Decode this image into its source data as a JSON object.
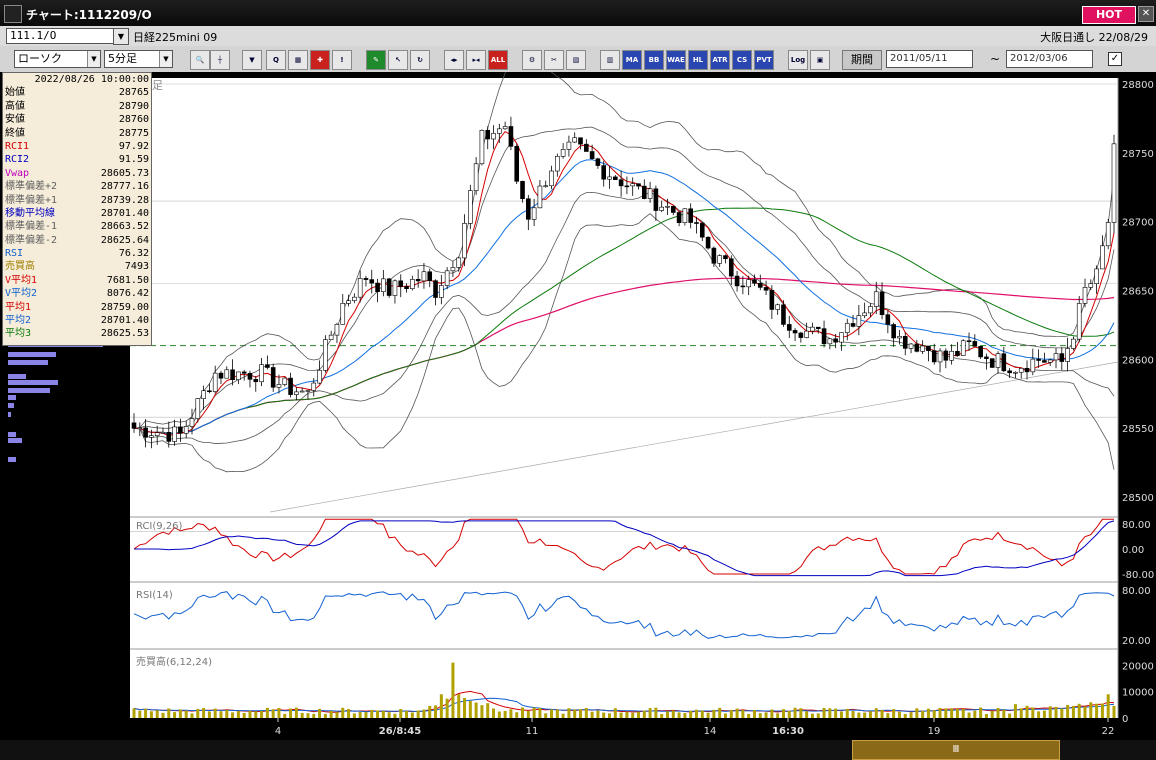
{
  "window": {
    "title": "チャート:1112209/O",
    "hot_label": "HOT"
  },
  "symbol": {
    "code": "111.1/O",
    "name": "日経225mini 09",
    "market": "大阪日通し  22/08/29"
  },
  "toolbar": {
    "chart_type": "ローソク",
    "interval": "5分足",
    "period_label": "期間",
    "date_from": "2011/05/11",
    "date_to": "2012/03/06",
    "buttons": [
      "MA",
      "BB",
      "WAE",
      "HL",
      "ATR",
      "CS",
      "PVT",
      "Log",
      "ALL"
    ]
  },
  "info": {
    "datetime": "2022/08/26  10:00:00",
    "rows": [
      {
        "label": "始値",
        "value": "28765",
        "color": "#000000"
      },
      {
        "label": "高値",
        "value": "28790",
        "color": "#000000"
      },
      {
        "label": "安値",
        "value": "28760",
        "color": "#000000"
      },
      {
        "label": "終値",
        "value": "28775",
        "color": "#000000"
      },
      {
        "label": "RCI1",
        "value": "97.92",
        "color": "#d40000"
      },
      {
        "label": "RCI2",
        "value": "91.59",
        "color": "#0000c0"
      },
      {
        "label": "Vwap",
        "value": "28605.73",
        "color": "#c000c0"
      },
      {
        "label": "標準偏差+2",
        "value": "28777.16",
        "color": "#606060"
      },
      {
        "label": "標準偏差+1",
        "value": "28739.28",
        "color": "#606060"
      },
      {
        "label": "移動平均線",
        "value": "28701.40",
        "color": "#0000c0"
      },
      {
        "label": "標準偏差-1",
        "value": "28663.52",
        "color": "#606060"
      },
      {
        "label": "標準偏差-2",
        "value": "28625.64",
        "color": "#606060"
      },
      {
        "label": "RSI",
        "value": "76.32",
        "color": "#1060d0"
      },
      {
        "label": "売買高",
        "value": "7493",
        "color": "#a08000"
      },
      {
        "label": "V平均1",
        "value": "7681.50",
        "color": "#d40000"
      },
      {
        "label": "V平均2",
        "value": "8076.42",
        "color": "#1060d0"
      },
      {
        "label": "平均1",
        "value": "28759.00",
        "color": "#d40000"
      },
      {
        "label": "平均2",
        "value": "28701.40",
        "color": "#1060d0"
      },
      {
        "label": "平均3",
        "value": "28625.53",
        "color": "#0a7a0a"
      }
    ]
  },
  "panels": {
    "main_label": "足",
    "rci_label": "RCI(9,26)",
    "rsi_label": "RSI(14)",
    "vol_label": "売買高(6,12,24)"
  },
  "axes": {
    "price_ticks": [
      "28800",
      "28750",
      "28700",
      "28650",
      "28600",
      "28550",
      "28500"
    ],
    "rci_ticks": [
      "80.00",
      "0.00",
      "-80.00"
    ],
    "rsi_ticks": [
      "80.00",
      "20.00"
    ],
    "vol_ticks": [
      "20000",
      "10000",
      "0"
    ],
    "x_ticks": [
      "4",
      "26/8:45",
      "11",
      "14",
      "16:30",
      "19",
      "22"
    ]
  },
  "colors": {
    "background": "#ffffff",
    "up": "#ffffff",
    "down": "#000000",
    "ma_fast": "#d40000",
    "ma_mid": "#1070e0",
    "ma_slow": "#0a7a0a",
    "vwap": "#e0106a",
    "volume": "#b0a000"
  }
}
